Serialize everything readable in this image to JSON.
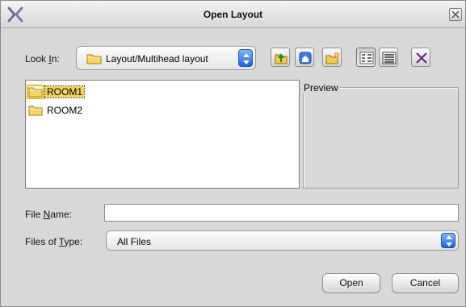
{
  "dialog": {
    "title": "Open Layout",
    "close_icon": "close-icon",
    "logo_icon": "x-logo-icon"
  },
  "look_in": {
    "label_pre": "Look ",
    "label_mnemonic": "I",
    "label_post": "n:",
    "value": "Layout/Multihead layout",
    "icon": "folder-icon"
  },
  "toolbar": {
    "buttons": [
      {
        "name": "up-folder-button",
        "icon": "up-folder-icon"
      },
      {
        "name": "home-button",
        "icon": "home-icon"
      },
      {
        "name": "new-folder-button",
        "icon": "new-folder-icon"
      },
      {
        "name": "list-view-button",
        "icon": "list-view-icon",
        "pressed": true
      },
      {
        "name": "details-view-button",
        "icon": "details-view-icon"
      },
      {
        "name": "delete-button",
        "icon": "delete-icon"
      }
    ]
  },
  "files": [
    {
      "name": "ROOM1",
      "selected": true
    },
    {
      "name": "ROOM2",
      "selected": false
    }
  ],
  "preview": {
    "title": "Preview"
  },
  "file_name": {
    "label_pre": "File ",
    "label_mnemonic": "N",
    "label_post": "ame:",
    "value": "",
    "placeholder": ""
  },
  "file_type": {
    "label_pre": "Files of ",
    "label_mnemonic": "T",
    "label_post": "ype:",
    "value": "All Files"
  },
  "buttons": {
    "open": "Open",
    "cancel": "Cancel"
  },
  "colors": {
    "background": "#d9d9d9",
    "selection": "#f3d35a",
    "spinner_blue": "#1e63d6"
  }
}
